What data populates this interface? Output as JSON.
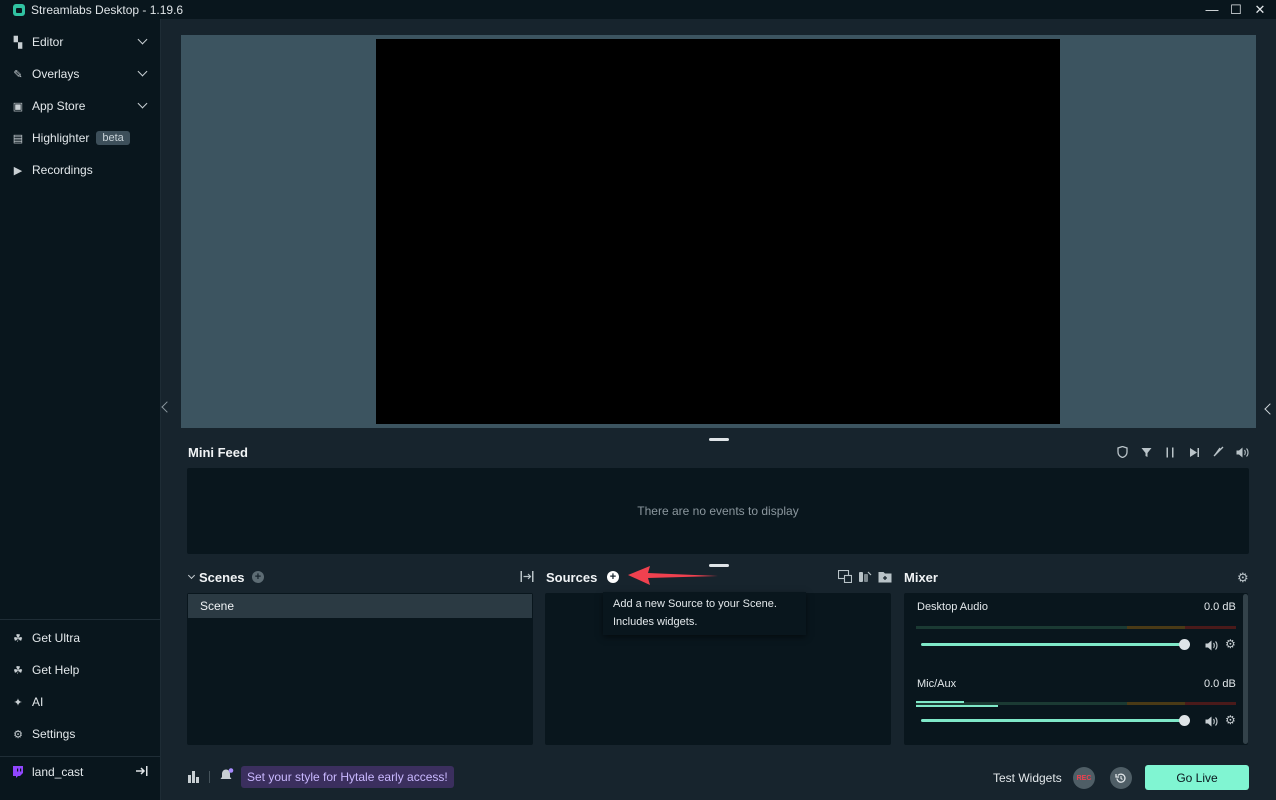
{
  "window": {
    "title": "Streamlabs Desktop - 1.19.6",
    "controls": {
      "minimize": "—",
      "maximize": "☐",
      "close": "✕"
    }
  },
  "sidebar": {
    "items": [
      {
        "label": "Editor",
        "icon": "editor-icon",
        "glyph": "▚"
      },
      {
        "label": "Overlays",
        "icon": "overlays-icon",
        "glyph": "✎"
      },
      {
        "label": "App Store",
        "icon": "store-icon",
        "glyph": "▣"
      },
      {
        "label": "Highlighter",
        "icon": "highlighter-icon",
        "glyph": "▤",
        "badge": "beta"
      },
      {
        "label": "Recordings",
        "icon": "play-circle-icon",
        "glyph": "▶"
      }
    ],
    "bottom_items": [
      {
        "label": "Get Ultra",
        "icon": "ultra-icon",
        "glyph": "☘"
      },
      {
        "label": "Get Help",
        "icon": "help-icon",
        "glyph": "☘"
      },
      {
        "label": "AI",
        "icon": "sparkle-icon",
        "glyph": "✦"
      },
      {
        "label": "Settings",
        "icon": "gear-icon",
        "glyph": "⚙"
      }
    ],
    "account": {
      "label": "land_cast",
      "icon": "twitch-icon",
      "logout_icon": "logout-icon"
    }
  },
  "minifeed": {
    "title": "Mini Feed",
    "empty_text": "There are no events to display",
    "tools": [
      "shield-icon",
      "filter-icon",
      "pause-icon",
      "skip-icon",
      "mute-alerts-icon",
      "volume-icon"
    ]
  },
  "scenes": {
    "title": "Scenes",
    "items": [
      "Scene"
    ]
  },
  "sources": {
    "title": "Sources",
    "tooltip_line1": "Add a new Source to your Scene.",
    "tooltip_line2": "Includes widgets."
  },
  "mixer": {
    "title": "Mixer",
    "channels": [
      {
        "name": "Desktop Audio",
        "db": "0.0 dB",
        "level": 1.0
      },
      {
        "name": "Mic/Aux",
        "db": "0.0 dB",
        "level": 1.0
      }
    ]
  },
  "footer": {
    "promo": "Set your style for Hytale early access!",
    "test_widgets": "Test Widgets",
    "rec": "REC",
    "go_live": "Go Live"
  },
  "colors": {
    "accent": "#80f5d2",
    "background": "#17242d",
    "panel": "#09161d",
    "preview_bg": "#3c5460",
    "promo_bg": "#3b2f5e",
    "annotation_arrow": "#f0414f"
  }
}
